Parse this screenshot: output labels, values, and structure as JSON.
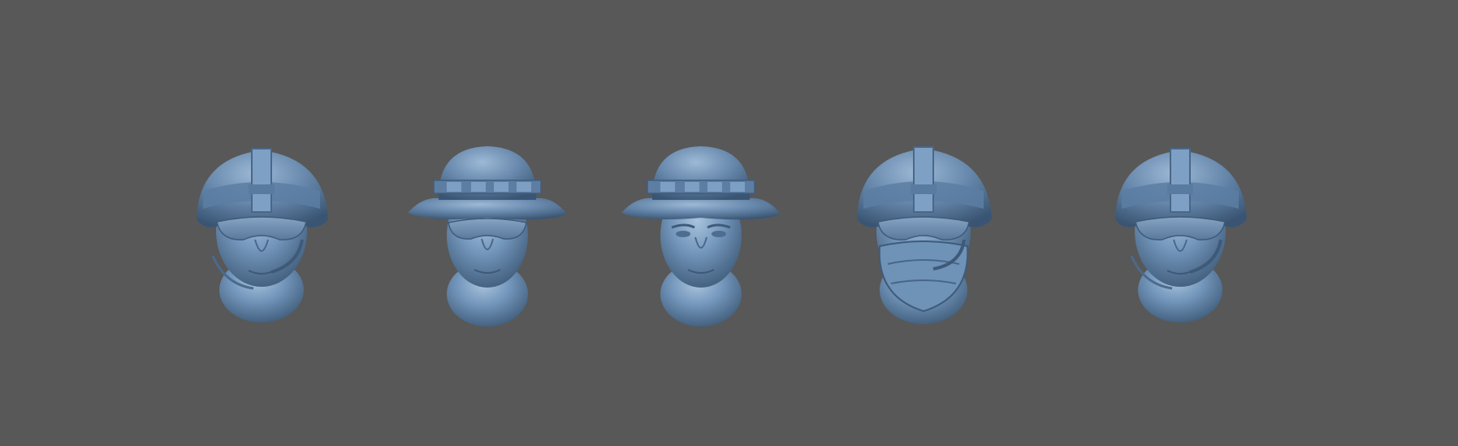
{
  "viewport": {
    "background": "#585858",
    "model_color": "#6e90b4"
  },
  "models": [
    {
      "id": "m1",
      "kind": "helmet-head-with-glasses-and-headset"
    },
    {
      "id": "m2",
      "kind": "boonie-hat-head-with-glasses"
    },
    {
      "id": "m3",
      "kind": "boonie-hat-head"
    },
    {
      "id": "m4",
      "kind": "helmet-head-with-glasses-and-face-cover"
    },
    {
      "id": "m5",
      "kind": "helmet-head-with-glasses-and-headset"
    }
  ]
}
